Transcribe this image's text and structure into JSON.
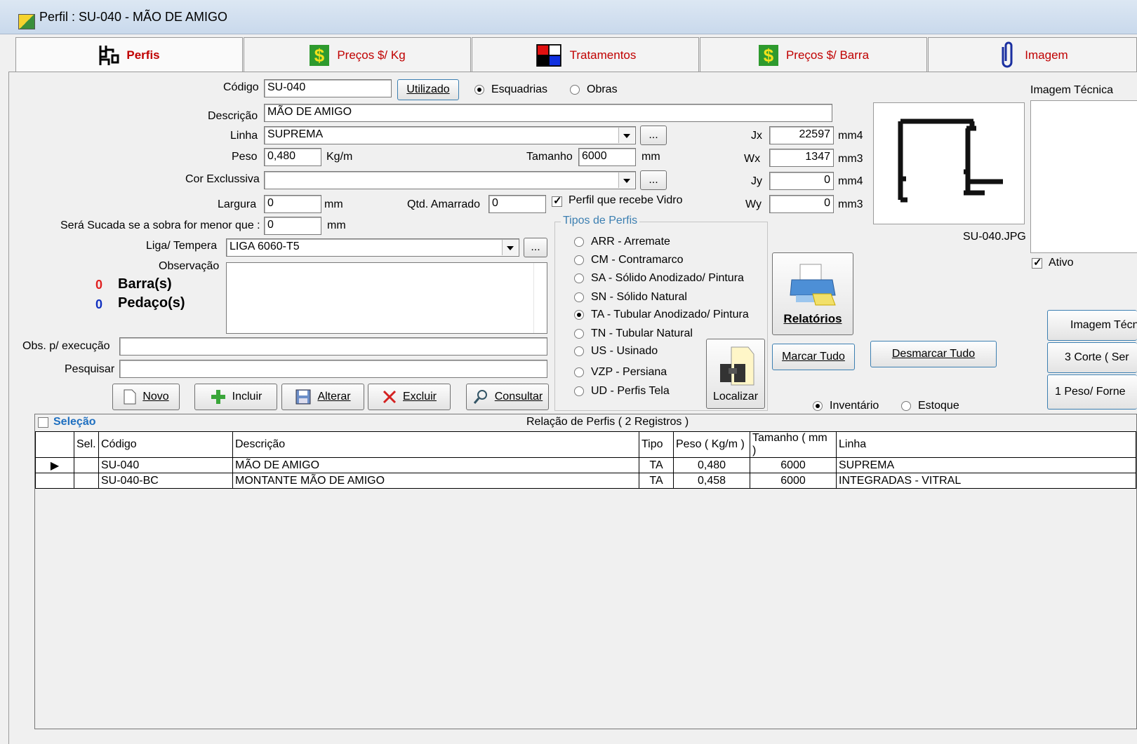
{
  "window": {
    "title": "Perfil : SU-040 - MÃO DE AMIGO"
  },
  "tabs": [
    {
      "label": "Perfis",
      "icon": "profile-icon"
    },
    {
      "label": "Preços $/ Kg",
      "icon": "dollar-icon"
    },
    {
      "label": "Tratamentos",
      "icon": "color-squares-icon"
    },
    {
      "label": "Preços $/ Barra",
      "icon": "dollar-icon"
    },
    {
      "label": "Imagem",
      "icon": "paperclip-icon"
    }
  ],
  "form": {
    "codigo_label": "Código",
    "codigo_value": "SU-040",
    "utilizado_button": "Utilizado",
    "radio_esquadrias": "Esquadrias",
    "radio_obras": "Obras",
    "descricao_label": "Descrição",
    "descricao_value": "MÃO DE AMIGO",
    "linha_label": "Linha",
    "linha_value": "SUPREMA",
    "ellipsis": "...",
    "peso_label": "Peso",
    "peso_value": "0,480",
    "peso_unit": "Kg/m",
    "tamanho_label": "Tamanho",
    "tamanho_value": "6000",
    "tamanho_unit": "mm",
    "cor_label": "Cor Exclussiva",
    "cor_value": "",
    "largura_label": "Largura",
    "largura_value": "0",
    "largura_unit": "mm",
    "qtd_label": "Qtd. Amarrado",
    "qtd_value": "0",
    "vidro_label": "Perfil que recebe Vidro",
    "sucada_label": "Será Sucada se a sobra for menor que :",
    "sucada_value": "0",
    "sucada_unit": "mm",
    "liga_label": "Liga/ Tempera",
    "liga_value": "LIGA 6060-T5",
    "observacao_label": "Observação",
    "barras_count": "0",
    "barras_label": "Barra(s)",
    "pedacos_count": "0",
    "pedacos_label": "Pedaço(s)",
    "obs_exec_label": "Obs. p/ execução",
    "obs_exec_value": "",
    "pesquisar_label": "Pesquisar",
    "pesquisar_value": ""
  },
  "inertia": {
    "jx_label": "Jx",
    "jx_value": "22597",
    "jx_unit": "mm4",
    "wx_label": "Wx",
    "wx_value": "1347",
    "wx_unit": "mm3",
    "jy_label": "Jy",
    "jy_value": "0",
    "jy_unit": "mm4",
    "wy_label": "Wy",
    "wy_value": "0",
    "wy_unit": "mm3"
  },
  "tipos": {
    "legend": "Tipos de Perfis",
    "options": [
      "ARR - Arremate",
      "CM - Contramarco",
      "SA - Sólido Anodizado/ Pintura",
      "SN - Sólido Natural",
      "TA - Tubular Anodizado/ Pintura",
      "TN - Tubular Natural",
      "US - Usinado",
      "VZP - Persiana",
      "UD - Perfis Tela"
    ],
    "selected_index": 4
  },
  "image": {
    "filename": "SU-040.JPG",
    "tecnica_label": "Imagem Técnica",
    "ativo_label": "Ativo"
  },
  "buttons": {
    "relatorios": "Relatórios",
    "localizar": "Localizar",
    "marcar_tudo": "Marcar Tudo",
    "desmarcar_tudo": "Desmarcar Tudo",
    "imagem_tecnica": "Imagem Técn",
    "corte": "3 Corte ( Ser",
    "peso_forne": "1 Peso/ Forne",
    "novo": "Novo",
    "incluir": "Incluir",
    "alterar": "Alterar",
    "excluir": "Excluir",
    "consultar": "Consultar"
  },
  "mode": {
    "inventario": "Inventário",
    "estoque": "Estoque"
  },
  "grid": {
    "selecao_label": "Seleção",
    "caption": "Relação de Perfis ( 2 Registros )",
    "columns": [
      "Sel.",
      "Código",
      "Descrição",
      "Tipo",
      "Peso ( Kg/m )",
      "Tamanho ( mm )",
      "Linha"
    ],
    "rows": [
      {
        "sel": "",
        "codigo": "SU-040",
        "descricao": "MÃO DE AMIGO",
        "tipo": "TA",
        "peso": "0,480",
        "tamanho": "6000",
        "linha": "SUPREMA"
      },
      {
        "sel": "",
        "codigo": "SU-040-BC",
        "descricao": "MONTANTE MÃO DE AMIGO",
        "tipo": "TA",
        "peso": "0,458",
        "tamanho": "6000",
        "linha": "INTEGRADAS - VITRAL"
      }
    ]
  },
  "colors": {
    "tab_text": "#c00000",
    "accent_blue": "#3c7fb1",
    "barras_red": "#e02020",
    "pedacos_blue": "#1030c0"
  }
}
